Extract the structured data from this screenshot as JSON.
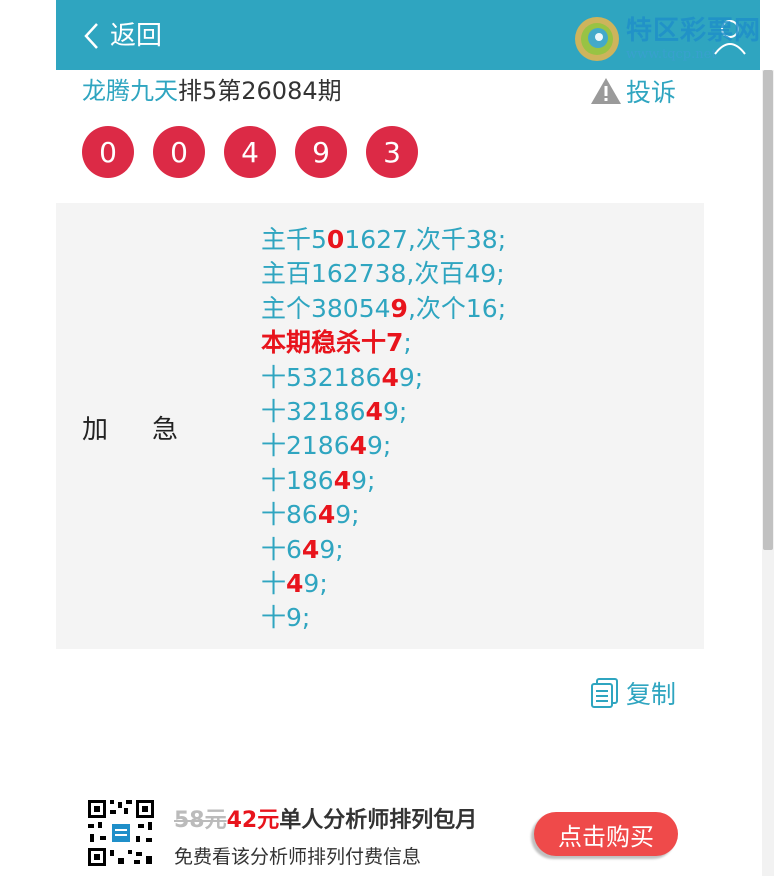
{
  "header": {
    "back_label": "返回",
    "bg_color": "#2fa5c0"
  },
  "logo": {
    "name": "特区彩票网",
    "url": "www.tqcp.net"
  },
  "title": {
    "name": "龙腾九天",
    "issue": "排5第26084期"
  },
  "complain_label": "投诉",
  "balls": [
    "0",
    "0",
    "4",
    "9",
    "3"
  ],
  "panel": {
    "label": "加急",
    "lines": [
      [
        {
          "t": "主千5"
        },
        {
          "t": "0",
          "hl": true
        },
        {
          "t": "1627,次千38;"
        }
      ],
      [
        {
          "t": "主百162738,次百49;"
        }
      ],
      [
        {
          "t": "主个38054"
        },
        {
          "t": "9",
          "hl": true
        },
        {
          "t": ",次个16;"
        }
      ],
      [
        {
          "t": "本期稳杀十7",
          "hl": true
        },
        {
          "t": ";"
        }
      ],
      [
        {
          "t": "十532186"
        },
        {
          "t": "4",
          "hl": true
        },
        {
          "t": "9;"
        }
      ],
      [
        {
          "t": "十32186"
        },
        {
          "t": "4",
          "hl": true
        },
        {
          "t": "9;"
        }
      ],
      [
        {
          "t": "十2186"
        },
        {
          "t": "4",
          "hl": true
        },
        {
          "t": "9;"
        }
      ],
      [
        {
          "t": "十186"
        },
        {
          "t": "4",
          "hl": true
        },
        {
          "t": "9;"
        }
      ],
      [
        {
          "t": "十86"
        },
        {
          "t": "4",
          "hl": true
        },
        {
          "t": "9;"
        }
      ],
      [
        {
          "t": "十6"
        },
        {
          "t": "4",
          "hl": true
        },
        {
          "t": "9;"
        }
      ],
      [
        {
          "t": "十"
        },
        {
          "t": "4",
          "hl": true
        },
        {
          "t": "9;"
        }
      ],
      [
        {
          "t": "十9;"
        }
      ]
    ]
  },
  "copy_label": "复制",
  "promo": {
    "old_price": "58元",
    "new_price": "42元",
    "desc": "单人分析师排列包月",
    "sub": "免费看该分析师排列付费信息",
    "buy_label": "点击购买"
  },
  "colors": {
    "accent": "#2fa5c0",
    "ball": "#dc2a46",
    "highlight": "#e8141c",
    "buy_button": "#ef4a4a"
  }
}
